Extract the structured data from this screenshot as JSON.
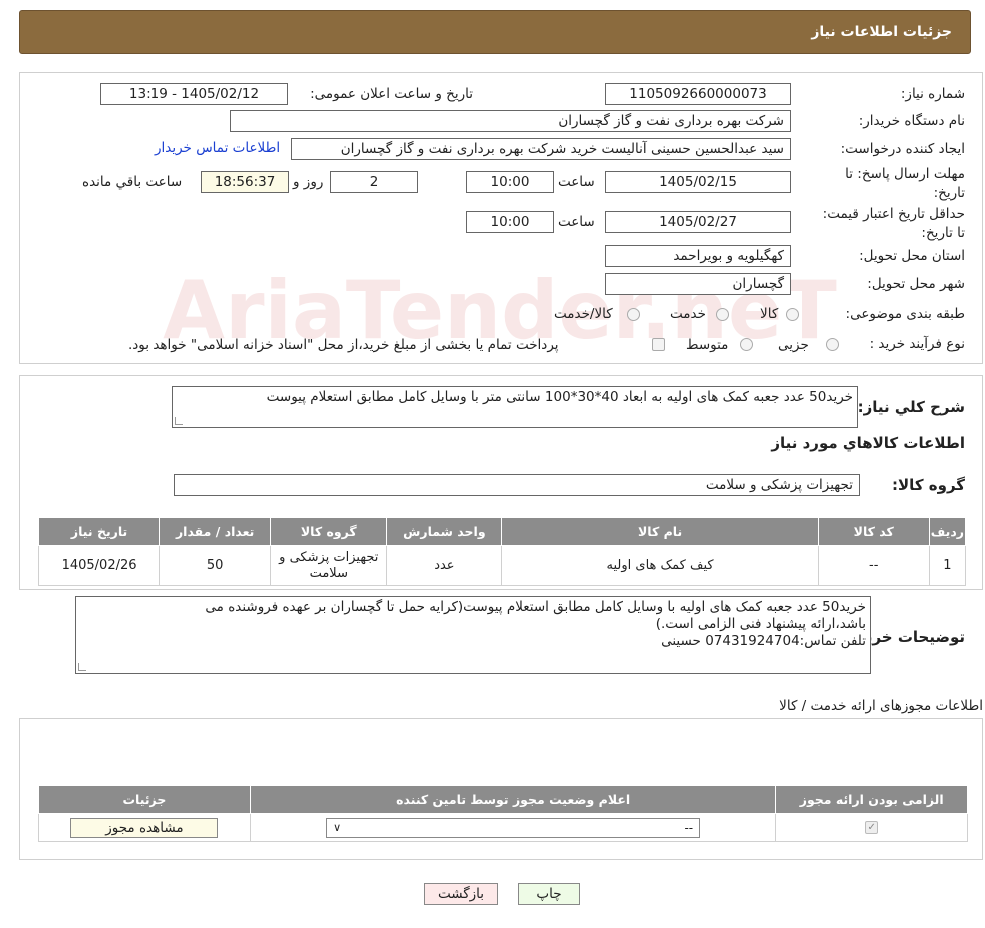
{
  "header": {
    "title": "جزئیات اطلاعات نیاز"
  },
  "need_no": {
    "label": "شماره نیاز:",
    "value": "1105092660000073"
  },
  "announce": {
    "label": "تاریخ و ساعت اعلان عمومی:",
    "value": "1405/02/12 - 13:19"
  },
  "buyer_org": {
    "label": "نام دستگاه خریدار:",
    "value": "شرکت بهره برداری نفت و گاز گچساران"
  },
  "creator": {
    "label": "ایجاد کننده درخواست:",
    "value": "سید عبدالحسین حسینی آنالیست خرید شرکت بهره برداری نفت و گاز گچساران",
    "contact_link": "اطلاعات تماس خریدار"
  },
  "deadline": {
    "label": "مهلت ارسال پاسخ: تا تاریخ:",
    "date": "1405/02/15",
    "time_label": "ساعت",
    "time": "10:00",
    "days": "2",
    "days_label": "روز و",
    "remaining": "18:56:37",
    "remaining_label": "ساعت باقي مانده"
  },
  "validity": {
    "label": "حداقل تاریخ اعتبار قیمت: تا تاریخ:",
    "date": "1405/02/27",
    "time_label": "ساعت",
    "time": "10:00"
  },
  "province": {
    "label": "استان محل تحویل:",
    "value": "کهگیلویه و بویراحمد"
  },
  "city": {
    "label": "شهر محل تحویل:",
    "value": "گچساران"
  },
  "category": {
    "label": "طبقه بندی موضوعی:",
    "options": [
      "کالا",
      "خدمت",
      "کالا/خدمت"
    ]
  },
  "process": {
    "label": "نوع فرآیند خرید :",
    "options": [
      "جزیی",
      "متوسط"
    ],
    "note": "پرداخت تمام یا بخشی از مبلغ خرید،از محل \"اسناد خزانه اسلامی\" خواهد بود."
  },
  "summary": {
    "label": "شرح کلي نياز:",
    "value": "خرید50 عدد جعبه کمک های اولیه به ابعاد 40*30*100 سانتی متر با وسایل کامل مطابق استعلام پیوست"
  },
  "goods_info_title": "اطلاعات کالاهاي مورد نياز",
  "goods_group": {
    "label": "گروه کالا:",
    "value": "تجهیزات پزشکی و سلامت"
  },
  "items_table": {
    "headers": [
      "رديف",
      "کد کالا",
      "نام کالا",
      "واحد شمارش",
      "گروه کالا",
      "تعداد / مقدار",
      "تاریخ نیاز"
    ],
    "rows": [
      [
        "1",
        "--",
        "کیف کمک های اولیه",
        "عدد",
        "تجهیزات پزشکی و سلامت",
        "50",
        "1405/02/26"
      ]
    ]
  },
  "buyer_notes": {
    "label": "توضیحات خریدار:",
    "lines": [
      "خرید50 عدد جعبه کمک های اولیه با وسایل کامل مطابق استعلام پیوست(کرایه حمل تا گچساران بر عهده فروشنده می",
      "باشد،ارائه پیشنهاد فنی الزامی است.)",
      "تلفن تماس:07431924704     حسینی"
    ]
  },
  "permits": {
    "title": "اطلاعات مجوزهای ارائه خدمت / کالا",
    "headers": [
      "الزامی بودن ارائه مجوز",
      "اعلام وضعیت مجوز توسط تامین کننده",
      "جزئیات"
    ],
    "select_value": "--",
    "view_button": "مشاهده مجوز"
  },
  "buttons": {
    "print": "چاپ",
    "back": "بازگشت"
  },
  "watermark": "AriaTender.neT",
  "colors": {
    "header": "#8b6b3e",
    "table_header": "#8c8c8c",
    "print_btn": "#eefbe6",
    "back_btn": "#fde9e9"
  }
}
